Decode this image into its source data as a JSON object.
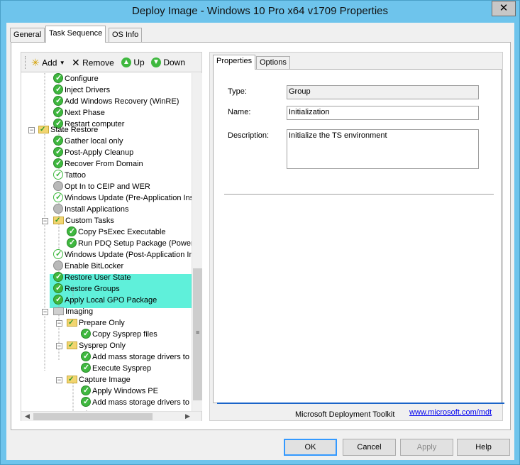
{
  "window": {
    "title": "Deploy Image - Windows 10 Pro x64 v1709 Properties",
    "close_glyph": "✕"
  },
  "tabs": [
    {
      "label": "General"
    },
    {
      "label": "Task Sequence"
    },
    {
      "label": "OS Info"
    }
  ],
  "toolbar": {
    "add_label": "Add",
    "remove_label": "Remove",
    "up_label": "Up",
    "down_label": "Down"
  },
  "tree": [
    {
      "label": "Configure",
      "icon": "green-check-icon"
    },
    {
      "label": "Inject Drivers",
      "icon": "green-check-icon"
    },
    {
      "label": "Add Windows Recovery (WinRE)",
      "icon": "green-check-icon"
    },
    {
      "label": "Next Phase",
      "icon": "green-check-icon"
    },
    {
      "label": "Restart computer",
      "icon": "green-check-icon"
    },
    {
      "label": "State Restore",
      "icon": "folder-icon"
    },
    {
      "label": "Gather local only",
      "icon": "green-check-icon"
    },
    {
      "label": "Post-Apply Cleanup",
      "icon": "green-check-icon"
    },
    {
      "label": "Recover From Domain",
      "icon": "green-check-icon"
    },
    {
      "label": "Tattoo",
      "icon": "outline-check-icon"
    },
    {
      "label": "Opt In to CEIP and WER",
      "icon": "grey-disabled-icon"
    },
    {
      "label": "Windows Update (Pre-Application Inst",
      "icon": "outline-check-icon"
    },
    {
      "label": "Install Applications",
      "icon": "grey-disabled-icon"
    },
    {
      "label": "Custom Tasks",
      "icon": "folder-icon"
    },
    {
      "label": "Copy PsExec Executable",
      "icon": "green-check-icon"
    },
    {
      "label": "Run PDQ Setup Package (Power",
      "icon": "green-check-icon"
    },
    {
      "label": "Windows Update (Post-Application Ins",
      "icon": "outline-check-icon"
    },
    {
      "label": "Enable BitLocker",
      "icon": "grey-disabled-icon"
    },
    {
      "label": "Restore User State",
      "icon": "green-check-icon"
    },
    {
      "label": "Restore Groups",
      "icon": "green-check-icon"
    },
    {
      "label": "Apply Local GPO Package",
      "icon": "green-check-icon"
    },
    {
      "label": "Imaging",
      "icon": "grey-folder-icon"
    },
    {
      "label": "Prepare Only",
      "icon": "folder-icon"
    },
    {
      "label": "Copy Sysprep files",
      "icon": "green-check-icon"
    },
    {
      "label": "Sysprep Only",
      "icon": "folder-icon"
    },
    {
      "label": "Add mass storage drivers to sy",
      "icon": "green-check-icon"
    },
    {
      "label": "Execute Sysprep",
      "icon": "green-check-icon"
    },
    {
      "label": "Capture Image",
      "icon": "folder-icon"
    },
    {
      "label": "Apply Windows PE",
      "icon": "green-check-icon"
    },
    {
      "label": "Add mass storage drivers to sy",
      "icon": "green-check-icon"
    }
  ],
  "properties": {
    "tabs": [
      {
        "label": "Properties"
      },
      {
        "label": "Options"
      }
    ],
    "type_label": "Type:",
    "type_value": "Group",
    "name_label": "Name:",
    "name_value": "Initialization",
    "description_label": "Description:",
    "description_value": "Initialize the TS environment",
    "footer_text": "Microsoft Deployment Toolkit",
    "footer_link": "www.microsoft.com/mdt"
  },
  "buttons": {
    "ok": "OK",
    "cancel": "Cancel",
    "apply": "Apply",
    "help": "Help"
  }
}
